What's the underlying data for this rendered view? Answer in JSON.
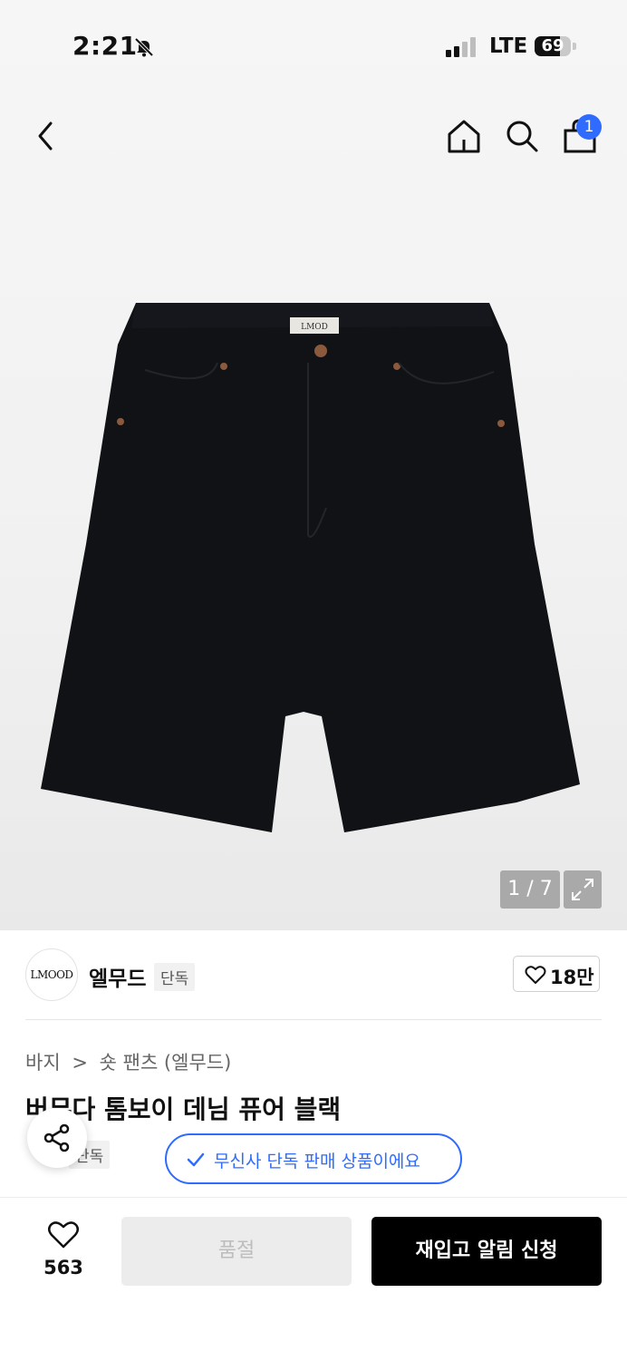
{
  "status_bar": {
    "time": "2:21",
    "network": "LTE",
    "battery": "69",
    "battery_level": 0.69
  },
  "header": {
    "cart_count": "1"
  },
  "gallery": {
    "counter": "1 / 7",
    "label_tag": "LMOD"
  },
  "brand": {
    "logo_text": "LMOOD",
    "name": "엘무드",
    "exclusive_tag": "단독",
    "likes": "18만"
  },
  "breadcrumb": {
    "category": "바지",
    "separator": ">",
    "subcategory": "숏 팬츠 (엘무드)"
  },
  "product": {
    "title": "버뮤다 톰보이 데님 퓨어 블랙",
    "exclusive_tag": "단독",
    "exclusive_notice": "무신사 단독 판매 상품이에요"
  },
  "bottom_bar": {
    "wish_count": "563",
    "sold_out_label": "품절",
    "restock_label": "재입고 알림 신청"
  },
  "colors": {
    "accent": "#2f6bff",
    "cta": "#000000",
    "disabled": "#ececec"
  },
  "icons": [
    "back-icon",
    "home-icon",
    "search-icon",
    "bag-icon",
    "expand-icon",
    "heart-icon",
    "share-icon",
    "check-icon"
  ]
}
